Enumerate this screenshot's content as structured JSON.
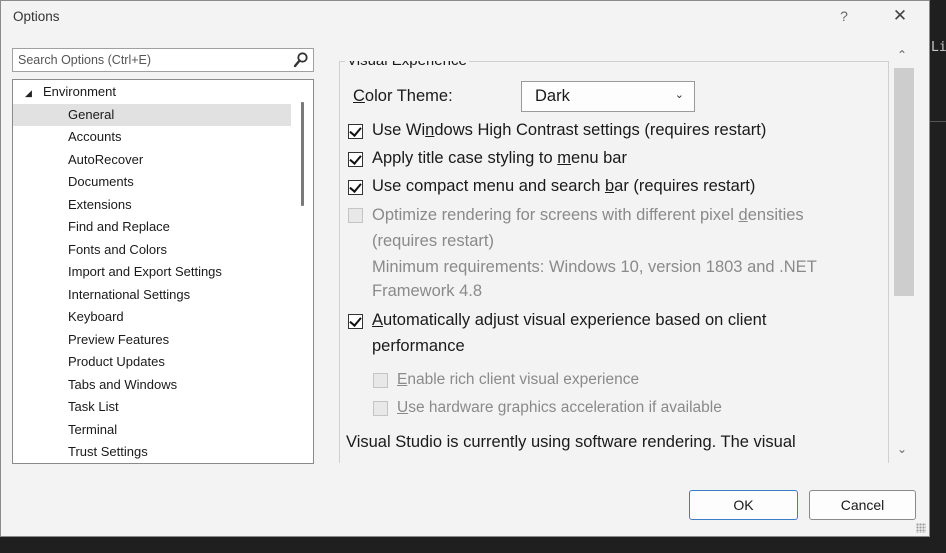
{
  "window": {
    "title": "Options",
    "help_label": "?",
    "close_label": "✕"
  },
  "background": {
    "code_fragment": "Lic"
  },
  "search": {
    "placeholder": "Search Options (Ctrl+E)",
    "icon": "search-icon"
  },
  "tree": {
    "root": "Environment",
    "root_state": "expanded",
    "selected": "General",
    "items": [
      "General",
      "Accounts",
      "AutoRecover",
      "Documents",
      "Extensions",
      "Find and Replace",
      "Fonts and Colors",
      "Import and Export Settings",
      "International Settings",
      "Keyboard",
      "Preview Features",
      "Product Updates",
      "Tabs and Windows",
      "Task List",
      "Terminal",
      "Trust Settings"
    ]
  },
  "panel": {
    "group_title": "Visual Experience",
    "color_theme": {
      "label_pre": "",
      "label_mnemonic": "C",
      "label_post": "olor Theme:",
      "value": "Dark"
    },
    "options": {
      "high_contrast": {
        "pre": "Use Wi",
        "mnemonic": "n",
        "post": "dows High Contrast settings (requires restart)",
        "checked": true
      },
      "title_case": {
        "pre": "Apply title case styling to ",
        "mnemonic": "m",
        "post": "enu bar",
        "checked": true
      },
      "compact_menu": {
        "pre": "Use compact menu and search ",
        "mnemonic": "b",
        "post": "ar (requires restart)",
        "checked": true
      },
      "optimize_rendering": {
        "pre": "Optimize rendering for screens with different pixel ",
        "mnemonic": "d",
        "post": "ensities",
        "line2": "(requires restart)",
        "line3": "Minimum requirements: Windows 10, version 1803 and .NET",
        "line4": "Framework 4.8",
        "checked": false,
        "enabled": false
      },
      "auto_adjust": {
        "pre": "",
        "mnemonic": "A",
        "post": "utomatically adjust visual experience based on client",
        "line2": "performance",
        "checked": true
      },
      "rich_client": {
        "pre": "",
        "mnemonic": "E",
        "post": "nable rich client visual experience",
        "checked": false,
        "enabled": false
      },
      "hw_accel": {
        "pre": "",
        "mnemonic": "U",
        "post": "se hardware graphics acceleration if available",
        "checked": false,
        "enabled": false
      }
    },
    "status_text": "Visual Studio is currently using software rendering.  The visual"
  },
  "buttons": {
    "ok": "OK",
    "cancel": "Cancel"
  },
  "colors": {
    "dialog_bg": "#f3f3f3",
    "selection_bg": "#e1e1e1",
    "primary_border": "#3b7ec8"
  }
}
